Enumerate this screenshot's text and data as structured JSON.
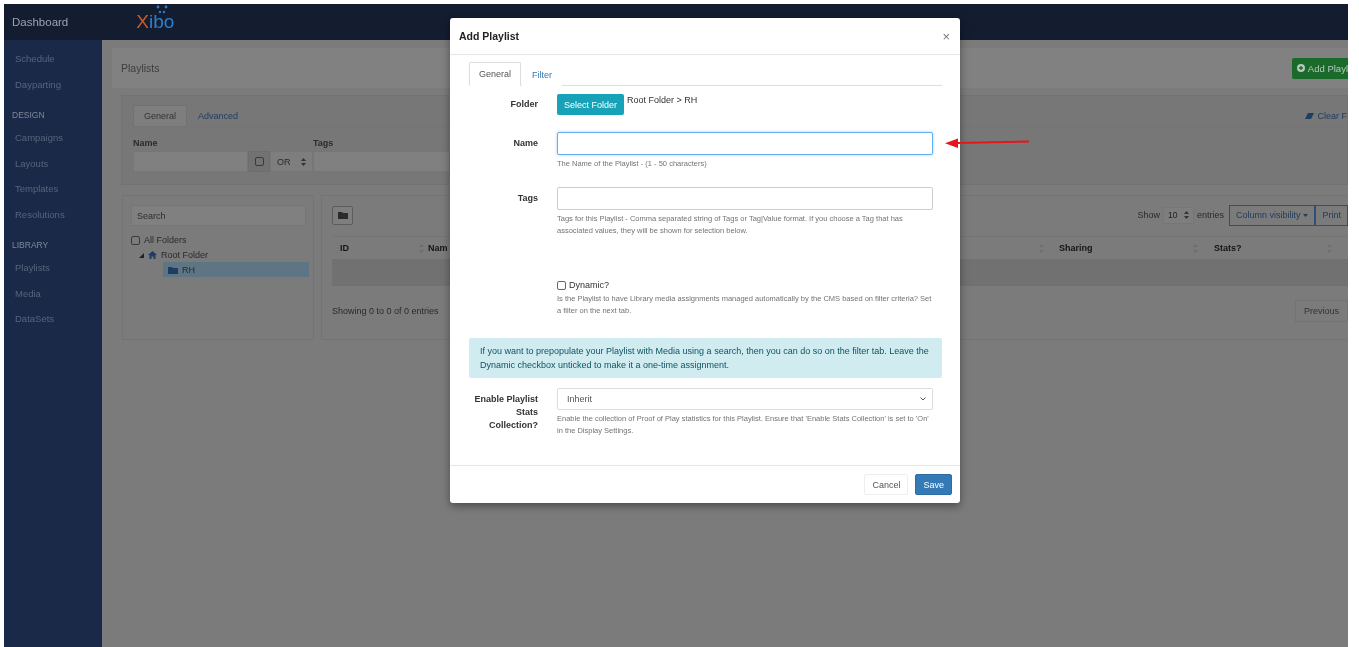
{
  "topbar": {
    "brand": "Dashboard",
    "logo": "Xibo"
  },
  "sidebar": {
    "items": [
      {
        "kind": "link",
        "label": "Schedule"
      },
      {
        "kind": "link",
        "label": "Dayparting"
      },
      {
        "kind": "heading",
        "label": "DESIGN"
      },
      {
        "kind": "link",
        "label": "Campaigns"
      },
      {
        "kind": "link",
        "label": "Layouts"
      },
      {
        "kind": "link",
        "label": "Templates"
      },
      {
        "kind": "link",
        "label": "Resolutions"
      },
      {
        "kind": "heading",
        "label": "LIBRARY"
      },
      {
        "kind": "link",
        "label": "Playlists"
      },
      {
        "kind": "link",
        "label": "Media"
      },
      {
        "kind": "link",
        "label": "DataSets"
      }
    ]
  },
  "page": {
    "title": "Playlists",
    "add_button": "Add Playl"
  },
  "filter": {
    "tabs": [
      {
        "label": "General",
        "selected": true
      },
      {
        "label": "Advanced",
        "selected": false
      }
    ],
    "clear_link": "Clear F",
    "name": {
      "label": "Name",
      "checked": false,
      "operator": "OR"
    },
    "tags": {
      "label": "Tags"
    }
  },
  "folders": {
    "search_placeholder": "Search",
    "all_folders": {
      "label": "All Folders",
      "checked": false
    },
    "tree": [
      {
        "label": "Root Folder",
        "expanded": true,
        "selected": false,
        "children": [
          {
            "label": "RH",
            "selected": true
          }
        ]
      }
    ]
  },
  "table": {
    "length": {
      "prefix": "Show",
      "value": "10",
      "suffix": "entries"
    },
    "buttons": [
      "Column visibility",
      "Print"
    ],
    "left_columns": [
      "ID",
      "Nam"
    ],
    "right_columns": [
      "Sharing",
      "Stats?"
    ],
    "info": "Showing 0 to 0 of 0 entries",
    "pager": [
      "Previous"
    ]
  },
  "dialog": {
    "title": "Add Playlist",
    "close": "×",
    "tabs": [
      {
        "label": "General",
        "selected": true
      },
      {
        "label": "Filter",
        "selected": false
      }
    ],
    "fields": [
      {
        "kind": "folder",
        "label": "Folder",
        "button": "Select Folder",
        "value": "Root Folder > RH"
      },
      {
        "kind": "text",
        "label": "Name",
        "focused": true,
        "help": "The Name of the Playlist - (1 - 50 characters)"
      },
      {
        "kind": "text",
        "label": "Tags",
        "focused": false,
        "help": "Tags for this Playlist - Comma separated string of Tags or Tag|Value format. If you choose a Tag that has associated values, they will be shown for selection below."
      },
      {
        "kind": "checkbox",
        "label": "Dynamic?",
        "checked": false,
        "help": "Is the Playlist to have Library media assignments managed automatically by the CMS based on filter criteria? Set a filter on the next tab."
      },
      {
        "kind": "alert",
        "text": "If you want to prepopulate your Playlist with Media using a search, then you can do so on the filter tab. Leave the Dynamic checkbox unticked to make it a one-time assignment."
      },
      {
        "kind": "select",
        "label": "Enable Playlist Stats Collection?",
        "value": "Inherit",
        "help": "Enable the collection of Proof of Play statistics for this Playlist. Ensure that 'Enable Stats Collection' is set to 'On' in the Display Settings."
      }
    ],
    "buttons": [
      {
        "kind": "default",
        "label": "Cancel"
      },
      {
        "kind": "primary",
        "label": "Save"
      }
    ]
  }
}
